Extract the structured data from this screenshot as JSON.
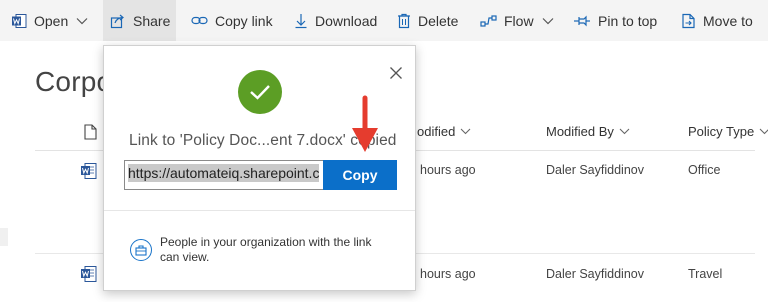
{
  "toolbar": {
    "open": "Open",
    "share": "Share",
    "copy_link": "Copy link",
    "download": "Download",
    "delete": "Delete",
    "flow": "Flow",
    "pin_to_top": "Pin to top",
    "move_to": "Move to"
  },
  "page": {
    "title": "Corpo"
  },
  "columns": {
    "modified": "odified",
    "modified_by": "Modified By",
    "policy_type": "Policy Type"
  },
  "rows": [
    {
      "modified": "hours ago",
      "modified_by": "Daler Sayfiddinov",
      "policy_type": "Office"
    },
    {
      "modified": "hours ago",
      "modified_by": "Daler Sayfiddinov",
      "policy_type": "Travel"
    }
  ],
  "dialog": {
    "message": "Link to 'Policy Doc...ent 7.docx' copied",
    "link_value": "https://automateiq.sharepoint.c",
    "copy_label": "Copy",
    "permission_text": "People in your organization with the link can view."
  },
  "colors": {
    "accent": "#0b6fc9",
    "success": "#5c9e25",
    "annotation": "#e53c2e",
    "word": "#2b579a"
  }
}
